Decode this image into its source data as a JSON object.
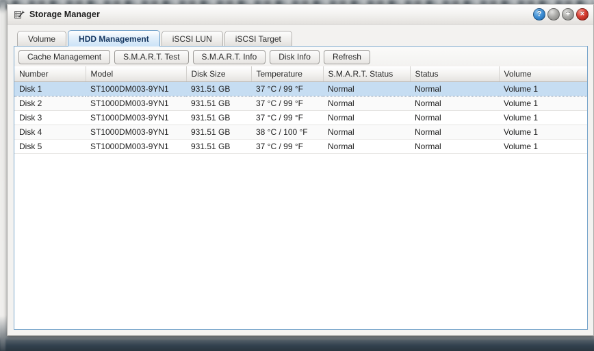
{
  "window": {
    "title": "Storage Manager",
    "icon": "storage-manager-icon",
    "controls": [
      {
        "name": "help-button",
        "glyph": "?",
        "label": "Help"
      },
      {
        "name": "minimize-button",
        "glyph": "",
        "label": "Minimize"
      },
      {
        "name": "maximize-button",
        "glyph": "+",
        "label": "Maximize"
      },
      {
        "name": "close-button",
        "glyph": "×",
        "label": "Close"
      }
    ]
  },
  "tabs": [
    {
      "label": "Volume",
      "active": false
    },
    {
      "label": "HDD Management",
      "active": true
    },
    {
      "label": "iSCSI LUN",
      "active": false
    },
    {
      "label": "iSCSI Target",
      "active": false
    }
  ],
  "toolbar": {
    "buttons": [
      {
        "label": "Cache Management"
      },
      {
        "label": "S.M.A.R.T. Test"
      },
      {
        "label": "S.M.A.R.T. Info"
      },
      {
        "label": "Disk Info"
      },
      {
        "label": "Refresh"
      }
    ]
  },
  "table": {
    "columns": [
      "Number",
      "Model",
      "Disk Size",
      "Temperature",
      "S.M.A.R.T. Status",
      "Status",
      "Volume"
    ],
    "rows": [
      {
        "number": "Disk 1",
        "model": "ST1000DM003-9YN1",
        "size": "931.51 GB",
        "temperature": "37 °C / 99 °F",
        "smart_status": "Normal",
        "status": "Normal",
        "volume": "Volume 1",
        "selected": true
      },
      {
        "number": "Disk 2",
        "model": "ST1000DM003-9YN1",
        "size": "931.51 GB",
        "temperature": "37 °C / 99 °F",
        "smart_status": "Normal",
        "status": "Normal",
        "volume": "Volume 1",
        "selected": false
      },
      {
        "number": "Disk 3",
        "model": "ST1000DM003-9YN1",
        "size": "931.51 GB",
        "temperature": "37 °C / 99 °F",
        "smart_status": "Normal",
        "status": "Normal",
        "volume": "Volume 1",
        "selected": false
      },
      {
        "number": "Disk 4",
        "model": "ST1000DM003-9YN1",
        "size": "931.51 GB",
        "temperature": "38 °C / 100 °F",
        "smart_status": "Normal",
        "status": "Normal",
        "volume": "Volume 1",
        "selected": false
      },
      {
        "number": "Disk 5",
        "model": "ST1000DM003-9YN1",
        "size": "931.51 GB",
        "temperature": "37 °C / 99 °F",
        "smart_status": "Normal",
        "status": "Normal",
        "volume": "Volume 1",
        "selected": false
      }
    ]
  },
  "colors": {
    "status_ok": "#179c45",
    "selected_row": "#c6ddf2",
    "panel_border": "#7ba7cc",
    "active_tab_text": "#14355f",
    "close_button": "#d94034",
    "help_button": "#3f8fd4"
  }
}
